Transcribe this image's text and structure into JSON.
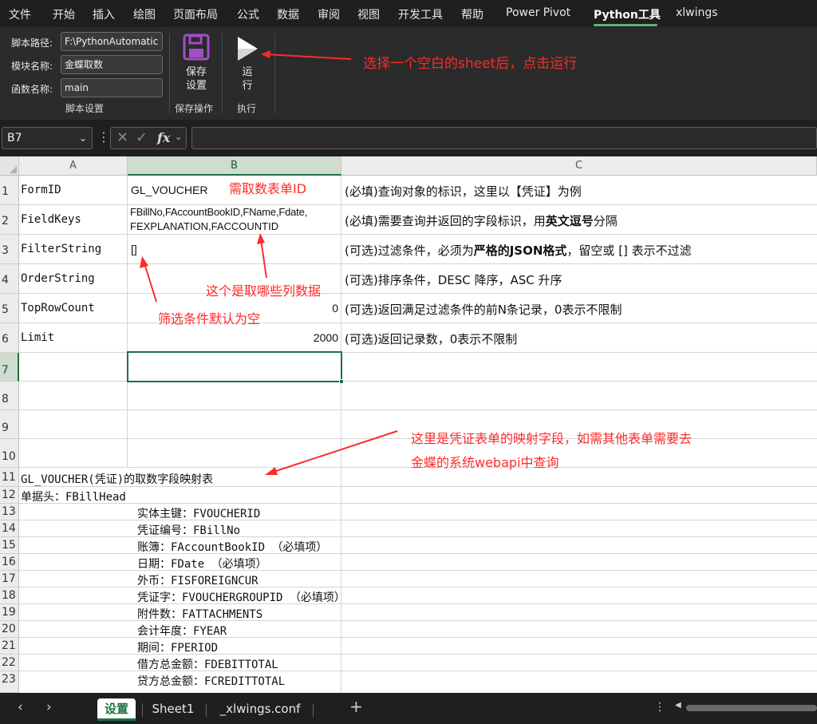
{
  "menu_tabs": [
    "文件",
    "开始",
    "插入",
    "绘图",
    "页面布局",
    "公式",
    "数据",
    "审阅",
    "视图",
    "开发工具",
    "帮助",
    "Power Pivot",
    "Python工具",
    "xlwings"
  ],
  "active_tab": "Python工具",
  "ribbon": {
    "script_path_label": "脚本路径:",
    "script_path_value": "F:\\PythonAutomatic",
    "module_label": "模块名称:",
    "module_value": "金蝶取数",
    "func_label": "函数名称:",
    "func_value": "main",
    "group_script": "脚本设置",
    "save_label": "保存\n设置",
    "group_save": "保存操作",
    "run_label": "运\n行",
    "group_run": "执行"
  },
  "formula_bar": {
    "namebox": "B7",
    "fx": "fx",
    "formula": ""
  },
  "columns": [
    "A",
    "B",
    "C"
  ],
  "selected_column": "B",
  "rows": [
    "1",
    "2",
    "3",
    "4",
    "5",
    "6",
    "7",
    "8",
    "9",
    "10",
    "11",
    "12",
    "13",
    "14",
    "15",
    "16",
    "17",
    "18",
    "19",
    "20",
    "21",
    "22",
    "23"
  ],
  "selected_row": "7",
  "cells": {
    "A1": "FormID",
    "A2": "FieldKeys",
    "A3": "FilterString",
    "A4": "OrderString",
    "A5": "TopRowCount",
    "A6": "Limit",
    "B1": "GL_VOUCHER",
    "B2_line1": "FBillNo,FAccountBookID,FName,Fdate,",
    "B2_line2": "FEXPLANATION,FACCOUNTID",
    "B3": "[]",
    "B5": "0",
    "B6": "2000",
    "C1": "(必填)查询对象的标识，这里以【凭证】为例",
    "C2_pre": "(必填)需要查询并返回的字段标识，用",
    "C2_bold": "英文逗号",
    "C2_post": "分隔",
    "C3_pre": "(可选)过滤条件，必须为",
    "C3_bold": "严格的JSON格式",
    "C3_post": "，留空或 [] 表示不过滤",
    "C4": "(可选)排序条件，DESC 降序，ASC 升序",
    "C5": "(可选)返回满足过滤条件的前N条记录，0表示不限制",
    "C6": "(可选)返回记录数，0表示不限制",
    "A11": "GL_VOUCHER(凭证)的取数字段映射表",
    "A12": "单据头：FBillHead",
    "mapping": [
      "实体主键：FVOUCHERID",
      "凭证编号：FBillNo",
      "账簿：FAccountBookID （必填项）",
      "日期：FDate （必填项）",
      "外币：FISFOREIGNCUR",
      "凭证字：FVOUCHERGROUPID （必填项）",
      "附件数：FATTACHMENTS",
      "会计年度：FYEAR",
      "期间：FPERIOD",
      "借方总金额：FDEBITTOTAL",
      "贷方总金额：FCREDITTOTAL"
    ]
  },
  "annotations": {
    "run_hint": "选择一个空白的sheet后，点击运行",
    "formid_hint": "需取数表单ID",
    "fields_hint": "这个是取哪些列数据",
    "filter_hint": "筛选条件默认为空",
    "mapping_hint_line1": "这里是凭证表单的映射字段，如需其他表单需要去",
    "mapping_hint_line2": "金蝶的系统webapi中查询"
  },
  "sheet_tabs": [
    "设置",
    "Sheet1",
    "_xlwings.conf"
  ],
  "active_sheet": "设置",
  "colors": {
    "excel_green": "#1e7145",
    "annotation_red": "#ff2a2a",
    "save_icon_purple": "#a24ec7"
  }
}
